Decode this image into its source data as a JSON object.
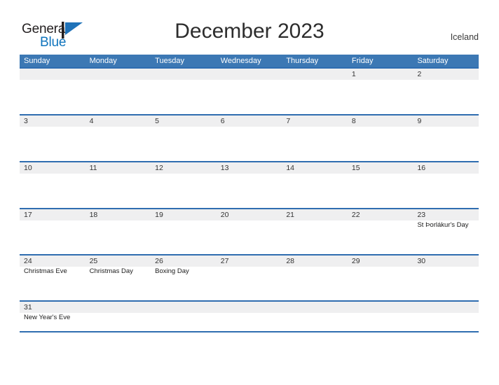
{
  "brand": {
    "word_one": "General",
    "word_two": "Blue",
    "flag_icon": "flag-triangle-icon",
    "word_one_color": "#231f20",
    "word_two_color": "#0f74bd",
    "flag_color": "#1f72b8"
  },
  "header": {
    "title": "December 2023",
    "locale": "Iceland"
  },
  "theme": {
    "header_blue": "#3c78b4",
    "rule_blue": "#2f6db0",
    "date_band_gray": "#efeff0",
    "page_background": "#ffffff"
  },
  "calendar": {
    "weekdays": [
      "Sunday",
      "Monday",
      "Tuesday",
      "Wednesday",
      "Thursday",
      "Friday",
      "Saturday"
    ],
    "weeks": [
      [
        {
          "date": "",
          "events": []
        },
        {
          "date": "",
          "events": []
        },
        {
          "date": "",
          "events": []
        },
        {
          "date": "",
          "events": []
        },
        {
          "date": "",
          "events": []
        },
        {
          "date": "1",
          "events": []
        },
        {
          "date": "2",
          "events": []
        }
      ],
      [
        {
          "date": "3",
          "events": []
        },
        {
          "date": "4",
          "events": []
        },
        {
          "date": "5",
          "events": []
        },
        {
          "date": "6",
          "events": []
        },
        {
          "date": "7",
          "events": []
        },
        {
          "date": "8",
          "events": []
        },
        {
          "date": "9",
          "events": []
        }
      ],
      [
        {
          "date": "10",
          "events": []
        },
        {
          "date": "11",
          "events": []
        },
        {
          "date": "12",
          "events": []
        },
        {
          "date": "13",
          "events": []
        },
        {
          "date": "14",
          "events": []
        },
        {
          "date": "15",
          "events": []
        },
        {
          "date": "16",
          "events": []
        }
      ],
      [
        {
          "date": "17",
          "events": []
        },
        {
          "date": "18",
          "events": []
        },
        {
          "date": "19",
          "events": []
        },
        {
          "date": "20",
          "events": []
        },
        {
          "date": "21",
          "events": []
        },
        {
          "date": "22",
          "events": []
        },
        {
          "date": "23",
          "events": [
            "St Þorlákur's Day"
          ]
        }
      ],
      [
        {
          "date": "24",
          "events": [
            "Christmas Eve"
          ]
        },
        {
          "date": "25",
          "events": [
            "Christmas Day"
          ]
        },
        {
          "date": "26",
          "events": [
            "Boxing Day"
          ]
        },
        {
          "date": "27",
          "events": []
        },
        {
          "date": "28",
          "events": []
        },
        {
          "date": "29",
          "events": []
        },
        {
          "date": "30",
          "events": []
        }
      ],
      [
        {
          "date": "31",
          "events": [
            "New Year's Eve"
          ]
        },
        {
          "date": "",
          "events": []
        },
        {
          "date": "",
          "events": []
        },
        {
          "date": "",
          "events": []
        },
        {
          "date": "",
          "events": []
        },
        {
          "date": "",
          "events": []
        },
        {
          "date": "",
          "events": []
        }
      ]
    ]
  }
}
